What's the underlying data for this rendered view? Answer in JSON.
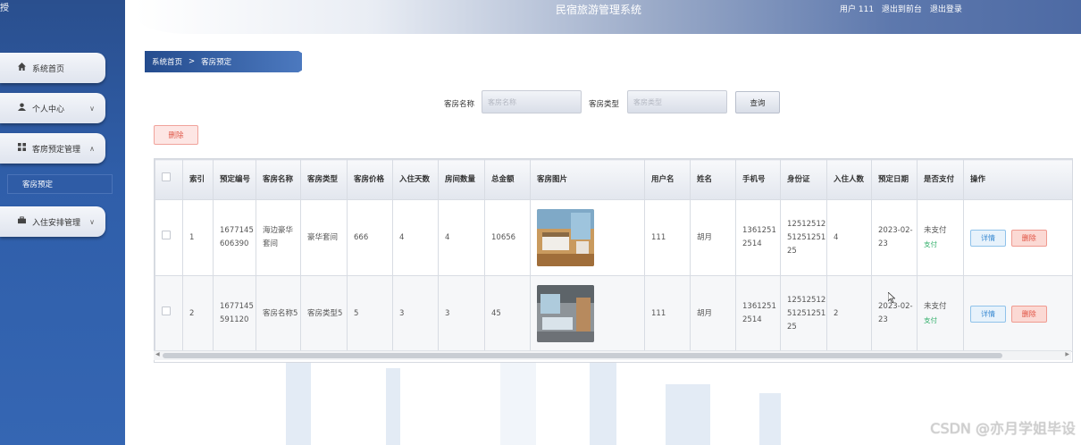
{
  "app": {
    "corner_mark": "授",
    "title": "民宿旅游管理系统",
    "user_label": "用户 111",
    "back_label": "退出到前台",
    "logout_label": "退出登录"
  },
  "sidebar": {
    "items": [
      {
        "label": "系统首页",
        "icon": "home-icon"
      },
      {
        "label": "个人中心",
        "icon": "user-icon"
      },
      {
        "label": "客房预定管理",
        "icon": "grid-icon"
      },
      {
        "label": "入住安排管理",
        "icon": "briefcase-icon"
      }
    ],
    "active_sub": "客房预定"
  },
  "breadcrumb": {
    "home": "系统首页",
    "separator": ">",
    "current": "客房预定"
  },
  "search": {
    "name_label": "客房名称",
    "name_placeholder": "客房名称",
    "type_label": "客房类型",
    "type_placeholder": "客房类型",
    "query_label": "查询"
  },
  "actions": {
    "delete_label": "删除"
  },
  "table": {
    "headers": [
      "",
      "索引",
      "预定编号",
      "客房名称",
      "客房类型",
      "客房价格",
      "入住天数",
      "房间数量",
      "总金额",
      "客房图片",
      "用户名",
      "姓名",
      "手机号",
      "身份证",
      "入住人数",
      "预定日期",
      "是否支付",
      "操作"
    ],
    "rows": [
      {
        "index": "1",
        "order_no": "1677145606390",
        "room_name": "海边豪华套间",
        "room_type": "豪华套间",
        "price": "666",
        "days": "4",
        "rooms": "4",
        "total": "10656",
        "username": "111",
        "name": "胡月",
        "phone": "13612512514",
        "id_card": "125125125125125125",
        "guests": "4",
        "date": "2023-02-23",
        "paid_status": "未支付",
        "pay_link": "支付"
      },
      {
        "index": "2",
        "order_no": "1677145591120",
        "room_name": "客房名称5",
        "room_type": "客房类型5",
        "price": "5",
        "days": "3",
        "rooms": "3",
        "total": "45",
        "username": "111",
        "name": "胡月",
        "phone": "13612512514",
        "id_card": "125125125125125125",
        "guests": "2",
        "date": "2023-02-23",
        "paid_status": "未支付",
        "pay_link": "支付"
      }
    ],
    "detail_label": "详情",
    "delete_label": "删除"
  },
  "watermark": "CSDN @亦月学姐毕设"
}
